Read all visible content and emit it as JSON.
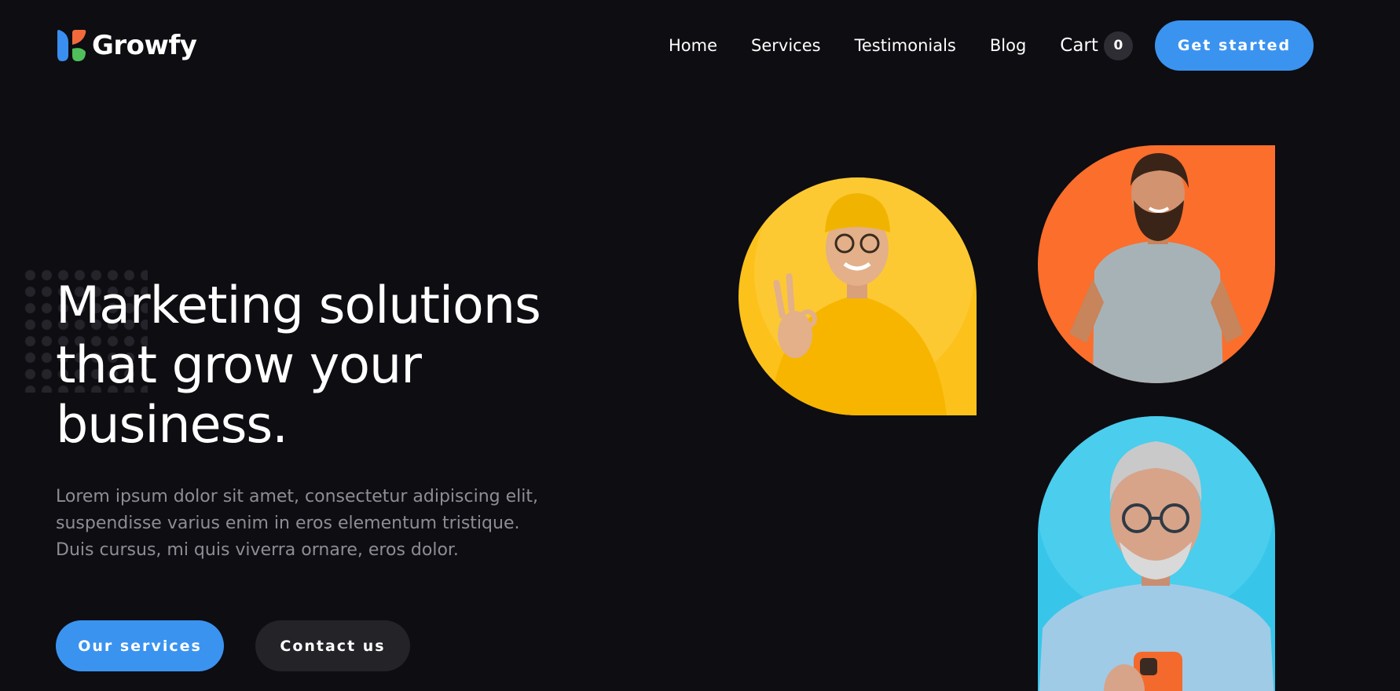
{
  "brand": {
    "name": "Growfy",
    "logo_icon": "growfy-logo-icon",
    "colors": {
      "accent": "#3b93f0",
      "background": "#0d0d12",
      "logo_blue": "#3a8ef0",
      "logo_orange": "#f26a3c",
      "logo_green": "#4fc05a"
    }
  },
  "nav": {
    "items": [
      {
        "label": "Home"
      },
      {
        "label": "Services"
      },
      {
        "label": "Testimonials"
      },
      {
        "label": "Blog"
      }
    ],
    "cart": {
      "label": "Cart",
      "count": "0"
    },
    "cta_label": "Get started"
  },
  "hero": {
    "title": "Marketing solutions that grow your business.",
    "description": "Lorem ipsum dolor sit amet, consectetur adipiscing elit, suspendisse varius enim in eros elementum tristique. Duis cursus, mi quis viverra ornare, eros dolor.",
    "primary_button": "Our services",
    "secondary_button": "Contact us"
  },
  "photos": [
    {
      "subject": "smiling man in yellow beanie making ok gesture",
      "background": "#fcc21b"
    },
    {
      "subject": "bearded man in grey t-shirt",
      "background": "#fb6e2c"
    },
    {
      "subject": "older man with glasses holding phone",
      "background": "#37c6ea"
    }
  ]
}
